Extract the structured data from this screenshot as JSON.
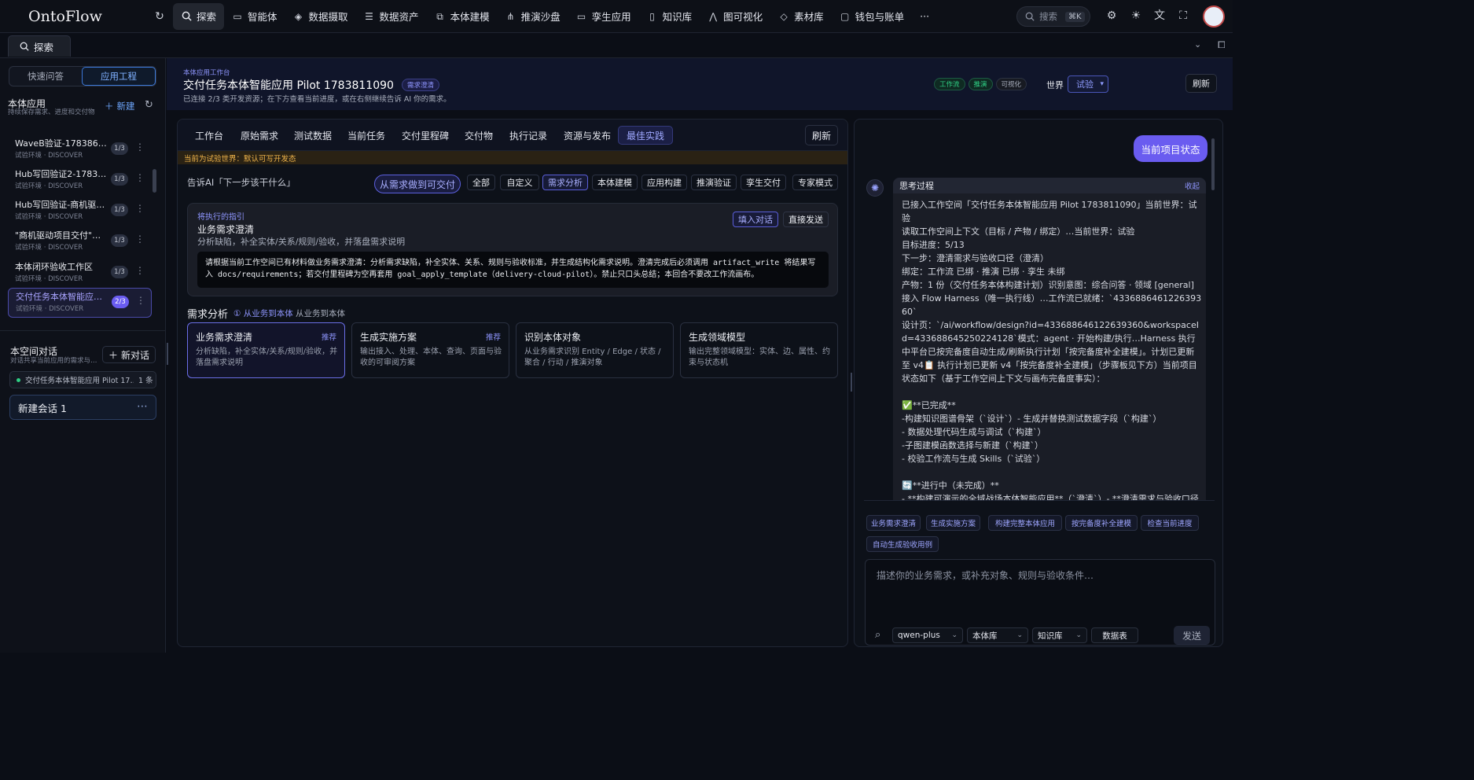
{
  "app": {
    "logo": "OntoFlow"
  },
  "nav": {
    "items": [
      {
        "label": "探索",
        "icon": "search-icon",
        "active": true
      },
      {
        "label": "智能体",
        "icon": "chat-icon"
      },
      {
        "label": "数据摄取",
        "icon": "layers-icon"
      },
      {
        "label": "数据资产",
        "icon": "database-icon"
      },
      {
        "label": "本体建模",
        "icon": "model-icon"
      },
      {
        "label": "推演沙盘",
        "icon": "graph-icon"
      },
      {
        "label": "孪生应用",
        "icon": "monitor-icon"
      },
      {
        "label": "知识库",
        "icon": "book-icon"
      },
      {
        "label": "图可视化",
        "icon": "network-icon"
      },
      {
        "label": "素材库",
        "icon": "stack-icon"
      },
      {
        "label": "钱包与账单",
        "icon": "wallet-icon"
      }
    ],
    "more": "···",
    "search_placeholder": "搜索",
    "search_shortcut": "⌘K"
  },
  "tabstrip": {
    "tab": "探索"
  },
  "sidebar": {
    "modes": [
      "快速问答",
      "应用工程"
    ],
    "section_title": "本体应用",
    "section_sub": "持续保存需求、进度和交付物",
    "new_label": "新建",
    "projects": [
      {
        "title": "WaveB验证-1783869457",
        "sub": "试验环境 · DISCOVER",
        "badge": "1/3"
      },
      {
        "title": "Hub写回验证2-1783868…",
        "sub": "试验环境 · DISCOVER",
        "badge": "1/3"
      },
      {
        "title": "Hub写回验证-商机驱动-…",
        "sub": "试验环境 · DISCOVER",
        "badge": "1/3"
      },
      {
        "title": "\"商机驱动项目交付\"案例",
        "sub": "试验环境 · DISCOVER",
        "badge": "1/3"
      },
      {
        "title": "本体闭环验收工作区",
        "sub": "试验环境 · DISCOVER",
        "badge": "1/3"
      },
      {
        "title": "交付任务本体智能应用 …",
        "sub": "试验环境 · DISCOVER",
        "badge": "2/3"
      }
    ],
    "conv_title": "本空间对话",
    "conv_sub": "对话共享当前应用的需求与…",
    "new_conv_label": "新对话",
    "conv_pill": "交付任务本体智能应用 Pilot 17…",
    "conv_pill_count": "1 条",
    "conv_item": "新建会话 1"
  },
  "header": {
    "eyebrow": "本体应用工作台",
    "title": "交付任务本体智能应用 Pilot 1783811090",
    "badge": "需求澄清",
    "subtitle": "已连接 2/3 类开发资源；在下方查看当前进度，或在右侧继续告诉 AI 你的需求。",
    "status_pills": [
      "工作流",
      "推演",
      "可视化"
    ],
    "world_label": "世界",
    "world_value": "试验",
    "refresh": "刷新"
  },
  "main": {
    "tabs": [
      "工作台",
      "原始需求",
      "测试数据",
      "当前任务",
      "交付里程碑",
      "交付物",
      "执行记录",
      "资源与发布",
      "最佳实践"
    ],
    "refresh": "刷新",
    "warning": "当前为试验世界：默认可写开发态",
    "ask_label": "告诉AI「下一步该干什么」",
    "primary_chip": "从需求做到可交付",
    "filters": [
      "全部",
      "自定义",
      "需求分析",
      "本体建模",
      "应用构建",
      "推演验证",
      "孪生交付",
      "专家模式"
    ],
    "guide": {
      "eyebrow": "将执行的指引",
      "title": "业务需求澄清",
      "desc": "分析缺陷，补全实体/关系/规则/验收，并落盘需求说明",
      "fill_btn": "填入对话",
      "send_btn": "直接发送",
      "code": "请根据当前工作空间已有材料做业务需求澄清：分析需求缺陷，补全实体、关系、规则与验收标准，并生成结构化需求说明。澄清完成后必须调用 artifact_write 将结果写入 docs/requirements；若交付里程碑为空再套用 goal_apply_template（delivery-cloud-pilot）。禁止只口头总结；本回合不要改工作流画布。"
    },
    "section_title": "需求分析",
    "section_step": "① 从业务到本体",
    "section_step2": "从业务到本体",
    "cards": [
      {
        "title": "业务需求澄清",
        "tag": "推荐",
        "desc": "分析缺陷，补全实体/关系/规则/验收，并落盘需求说明"
      },
      {
        "title": "生成实施方案",
        "tag": "推荐",
        "desc": "输出接入、处理、本体、查询、页面与验收的可审阅方案"
      },
      {
        "title": "识别本体对象",
        "tag": "",
        "desc": "从业务需求识别 Entity / Edge / 状态 / 聚合 / 行动 / 推演对象"
      },
      {
        "title": "生成领域模型",
        "tag": "",
        "desc": "输出完整领域模型：实体、边、属性、约束与状态机"
      }
    ]
  },
  "chat": {
    "user_message": "当前项目状态",
    "think_title": "思考过程",
    "think_collapse": "收起",
    "think_lines": [
      "已接入工作空间「交付任务本体智能应用 Pilot 1783811090」当前世界：试验",
      "读取工作空间上下文（目标 / 产物 / 绑定）…当前世界：试验",
      "目标进度：5/13",
      "下一步：澄清需求与验收口径（澄清）",
      "绑定：工作流 已绑 · 推演 已绑 · 孪生 未绑",
      "产物：1 份（交付任务本体构建计划）识别意图：综合问答 · 领域 [general]接入 Flow Harness（唯一执行线）…工作流已就绪：`433688646122639360`",
      "设计页：`/ai/workflow/design?id=433688646122639360&workspaceId=433688645250224128`模式：agent · 开始构建/执行…Harness 执行中平台已按完备度自动生成/刷新执行计划「按完备度补全建模」。计划已更新至 v4📋 执行计划已更新 v4「按完备度补全建模」（步骤板见下方）当前项目状态如下（基于工作空间上下文与画布完备度事实）：",
      "",
      "✅**已完成**",
      "-构建知识图谱骨架（`设计`）- 生成并替换测试数据字段（`构建`）",
      "- 数据处理代码生成与调试（`构建`）",
      "-子图建模函数选择与新建（`构建`）",
      "- 校验工作流与生成 Skills（`试验`）",
      "",
      "🔄**进行中（未完成）**",
      "- **构建可演示的全域战场本体智能应用**（`澄清`）- **澄清需求与验收口径**（`澄清`）→ **当前首要任务**"
    ],
    "quick_chips": [
      "业务需求澄清",
      "生成实施方案",
      "构建完整本体应用",
      "按完备度补全建模",
      "检查当前进度",
      "自动生成验收用例"
    ],
    "input_placeholder": "描述你的业务需求，或补充对象、规则与验收条件…",
    "model": "qwen-plus",
    "kb1": "本体库",
    "kb2": "知识库",
    "table_btn": "数据表",
    "send": "发送"
  },
  "colors": {
    "accent": "#6a5cf0",
    "warn": "#f0b44a",
    "success": "#2fcf84"
  }
}
